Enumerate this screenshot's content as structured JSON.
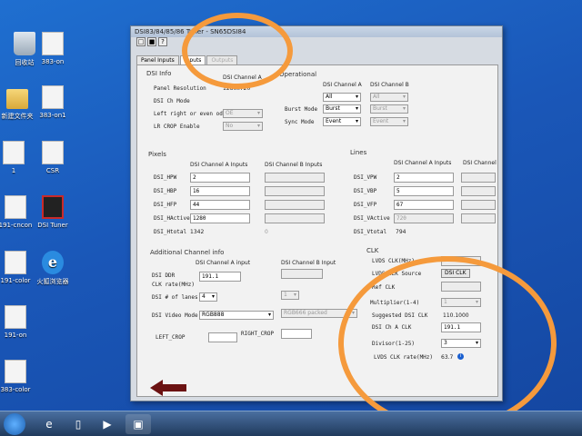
{
  "desktop": {
    "icons": [
      "回收站",
      "383-on",
      "新建文件夹",
      "383-on1",
      "1",
      "CSR",
      "191-cncon",
      "DSI Tuner",
      "191-color",
      "火狐浏览器",
      "191-on",
      "383-color"
    ]
  },
  "window": {
    "title": "DSI83/84/85/86 Tuner - SN65DSI84",
    "tabs": [
      "Panel Inputs",
      "Inputs",
      "Outputs"
    ]
  },
  "dsi_info": {
    "heading": "DSI Info",
    "col_a": "DSI Channel A",
    "col_b": "DSI Channel B",
    "panel_resolution_label": "Panel Resolution",
    "panel_resolution_value": "1280x720",
    "ch_mode_label": "DSI Ch Mode",
    "lr_odd_label": "Left right or even odd",
    "lr_odd_value": "OE",
    "lr_crop_label": "LR CROP Enable",
    "lr_crop_value": "No"
  },
  "operational": {
    "heading": "Operational",
    "col_a": "DSI Channel A",
    "col_b": "DSI Channel B",
    "row1_a": "All",
    "row1_b": "All",
    "burst_label": "Burst Mode",
    "burst_a": "Burst",
    "burst_b": "Burst",
    "sync_label": "Sync Mode",
    "sync_a": "Event",
    "sync_b": "Event"
  },
  "pixels": {
    "heading": "Pixels",
    "col_a": "DSI Channel A Inputs",
    "col_b": "DSI Channel B Inputs",
    "hpw_label": "DSI_HPW",
    "hpw_value": "2",
    "hbp_label": "DSI_HBP",
    "hbp_value": "16",
    "hfp_label": "DSI_HFP",
    "hfp_value": "44",
    "hactive_label": "DSI_HActive",
    "hactive_value": "1280",
    "htotal_label": "DSI_Htotal",
    "htotal_value": "1342",
    "htotal_b": "0"
  },
  "lines": {
    "heading": "Lines",
    "col_a": "DSI Channel A Inputs",
    "col_b": "DSI Channel",
    "vpw_label": "DSI_VPW",
    "vpw_value": "2",
    "vbp_label": "DSI_VBP",
    "vbp_value": "5",
    "vfp_label": "DSI_VFP",
    "vfp_value": "67",
    "vactive_label": "DSI_VActive",
    "vactive_value": "720",
    "vtotal_label": "DSI_Vtotal",
    "vtotal_value": "794"
  },
  "additional": {
    "heading": "Additional Channel info",
    "col_a": "DSI Channel A input",
    "col_b": "DSI Channel B Input",
    "ddr_label": "DSI DDR",
    "ddr_label2": "CLK rate(MHz)",
    "ddr_value": "191.1",
    "lanes_label": "DSI # of lanes",
    "lanes_a": "4",
    "lanes_b": "1",
    "video_label": "DSI Video Mode",
    "video_a": "RGB888",
    "video_b": "RGB666 packed",
    "left_crop_label": "LEFT_CROP",
    "right_crop_label": "RIGHT_CROP"
  },
  "clk": {
    "heading": "CLK",
    "lvds_clk_label": "LVDS CLK(MHz)",
    "lvds_source_label": "LVDS CLK Source",
    "lvds_source_value": "DSI CLK",
    "ref_clk_label": "Ref CLK",
    "multiplier_label": "Multiplier(1-4)",
    "multiplier_value": "1",
    "suggested_label": "Suggested DSI CLK",
    "suggested_value": "110.1000",
    "ch_a_clk_label": "DSI Ch A CLK",
    "ch_a_clk_value": "191.1",
    "divisor_label": "Divisor(1-25)",
    "divisor_value": "3",
    "lvds_rate_label": "LVDS CLK rate(MHz)",
    "lvds_rate_value": "63.7"
  },
  "colors": {
    "annotation": "#f59a3c",
    "arrow": "#6b1212"
  }
}
